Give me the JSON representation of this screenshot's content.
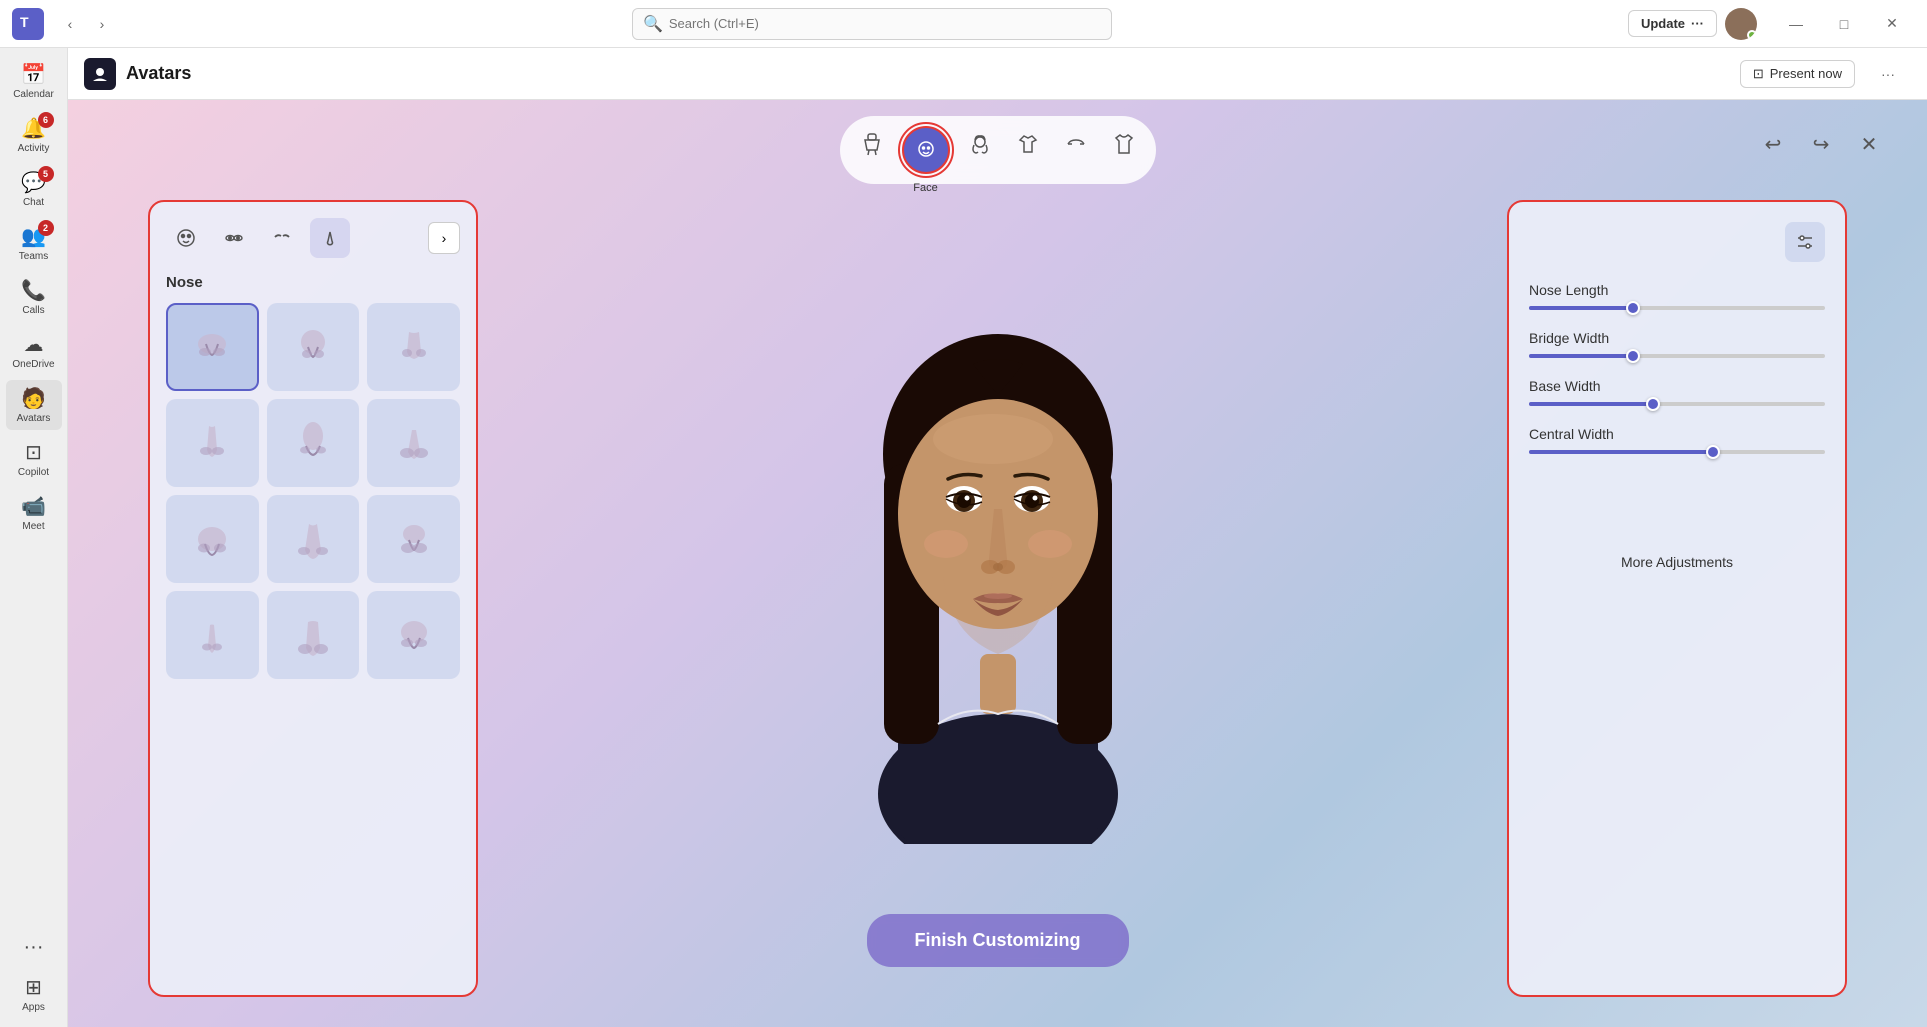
{
  "titlebar": {
    "logo": "T",
    "search_placeholder": "Search (Ctrl+E)",
    "update_label": "Update",
    "update_dots": "···",
    "minimize": "—",
    "maximize": "□",
    "close": "✕"
  },
  "sidebar": {
    "items": [
      {
        "id": "calendar",
        "label": "Calendar",
        "icon": "📅",
        "badge": null
      },
      {
        "id": "activity",
        "label": "Activity",
        "icon": "🔔",
        "badge": "6"
      },
      {
        "id": "chat",
        "label": "Chat",
        "icon": "💬",
        "badge": "5"
      },
      {
        "id": "teams",
        "label": "Teams",
        "icon": "👥",
        "badge": "2"
      },
      {
        "id": "calls",
        "label": "Calls",
        "icon": "📞",
        "badge": null
      },
      {
        "id": "onedrive",
        "label": "OneDrive",
        "icon": "☁",
        "badge": null
      },
      {
        "id": "avatars",
        "label": "Avatars",
        "icon": "🧑",
        "badge": null,
        "active": true
      },
      {
        "id": "copilot",
        "label": "Copilot",
        "icon": "⊡",
        "badge": null
      },
      {
        "id": "meet",
        "label": "Meet",
        "icon": "📹",
        "badge": null
      },
      {
        "id": "more",
        "label": "···",
        "icon": "···",
        "badge": null
      },
      {
        "id": "apps",
        "label": "Apps",
        "icon": "⊞",
        "badge": null
      }
    ]
  },
  "app_header": {
    "icon": "A",
    "title": "Avatars",
    "present_now": "Present now",
    "more": "···"
  },
  "toolbar": {
    "buttons": [
      {
        "id": "body",
        "icon": "🗿",
        "label": ""
      },
      {
        "id": "face",
        "icon": "😐",
        "label": "Face",
        "active": true
      },
      {
        "id": "hair",
        "icon": "👤",
        "label": ""
      },
      {
        "id": "outfit",
        "icon": "👔",
        "label": ""
      },
      {
        "id": "accessories",
        "icon": "🎩",
        "label": ""
      },
      {
        "id": "clothing",
        "icon": "👕",
        "label": ""
      }
    ],
    "undo_icon": "↩",
    "redo_icon": "↪",
    "close_icon": "✕"
  },
  "left_panel": {
    "tabs": [
      {
        "id": "shape",
        "icon": "⊙"
      },
      {
        "id": "eyes",
        "icon": "👁"
      },
      {
        "id": "brows",
        "icon": "〰"
      },
      {
        "id": "nose",
        "icon": "⌒",
        "active": true
      }
    ],
    "section_title": "Nose",
    "nose_items": [
      {
        "id": "nose1"
      },
      {
        "id": "nose2"
      },
      {
        "id": "nose3"
      },
      {
        "id": "nose4"
      },
      {
        "id": "nose5"
      },
      {
        "id": "nose6"
      },
      {
        "id": "nose7"
      },
      {
        "id": "nose8"
      },
      {
        "id": "nose9"
      },
      {
        "id": "nose10"
      },
      {
        "id": "nose11"
      },
      {
        "id": "nose12"
      }
    ]
  },
  "right_panel": {
    "sliders": [
      {
        "id": "nose_length",
        "label": "Nose Length",
        "value": 35
      },
      {
        "id": "bridge_width",
        "label": "Bridge Width",
        "value": 35
      },
      {
        "id": "base_width",
        "label": "Base Width",
        "value": 42
      },
      {
        "id": "central_width",
        "label": "Central Width",
        "value": 62
      }
    ],
    "more_adjustments": "More Adjustments"
  },
  "finish_button": {
    "label": "Finish Customizing"
  }
}
